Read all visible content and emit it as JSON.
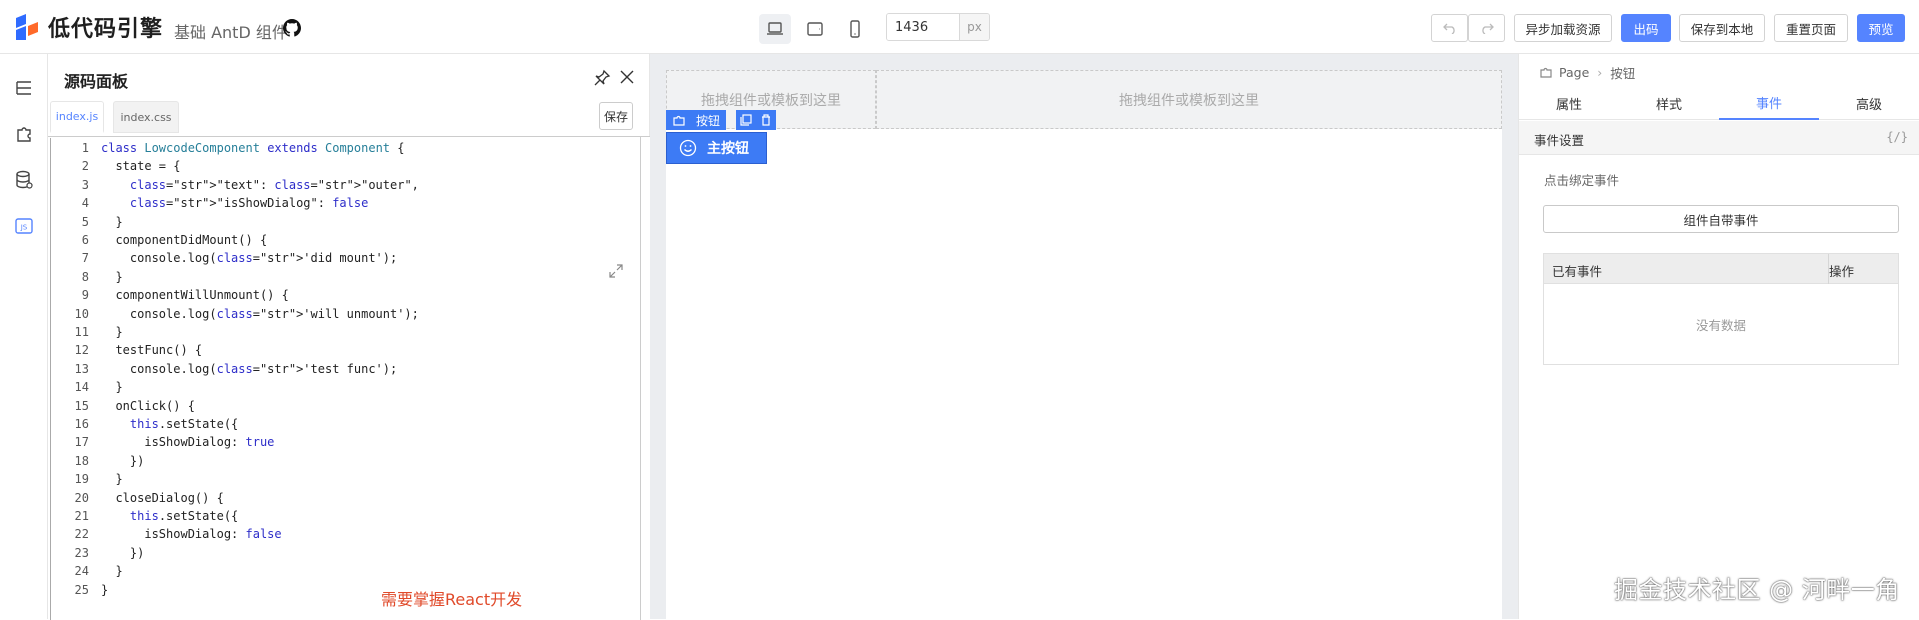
{
  "header": {
    "brand": "低代码引擎",
    "subtitle": "基础 AntD 组件",
    "width_value": "1436",
    "width_unit": "px",
    "buttons": {
      "async_load": "异步加载资源",
      "export_code": "出码",
      "save_local": "保存到本地",
      "reset_page": "重置页面",
      "preview": "预览"
    },
    "colors": {
      "primary": "#5584ff"
    }
  },
  "source_panel": {
    "title": "源码面板",
    "tabs": [
      "index.js",
      "index.css"
    ],
    "save_label": "保存",
    "lines": [
      "class LowcodeComponent extends Component {",
      "  state = {",
      "    \"text\": \"outer\",",
      "    \"isShowDialog\": false",
      "  }",
      "  componentDidMount() {",
      "    console.log('did mount');",
      "  }",
      "  componentWillUnmount() {",
      "    console.log('will unmount');",
      "  }",
      "  testFunc() {",
      "    console.log('test func');",
      "  }",
      "  onClick() {",
      "    this.setState({",
      "      isShowDialog: true",
      "    })",
      "  }",
      "  closeDialog() {",
      "    this.setState({",
      "      isShowDialog: false",
      "    })",
      "  }",
      "}"
    ],
    "annotation": "需要掌握React开发"
  },
  "canvas": {
    "drop_hint_1": "拖拽组件或模板到这里",
    "drop_hint_2": "拖拽组件或模板到这里",
    "selected_label": "按钮",
    "main_button": "主按钮"
  },
  "settings_panel": {
    "breadcrumb": [
      "Page",
      "按钮"
    ],
    "tabs": [
      "属性",
      "样式",
      "事件",
      "高级"
    ],
    "active_tab": "事件",
    "section_title": "事件设置",
    "section_icon": "{/}",
    "bind_label": "点击绑定事件",
    "builtin_button": "组件自带事件",
    "table_headers": [
      "已有事件",
      "操作"
    ],
    "empty_text": "没有数据"
  },
  "watermark": "掘金技术社区 @ 河畔一角"
}
